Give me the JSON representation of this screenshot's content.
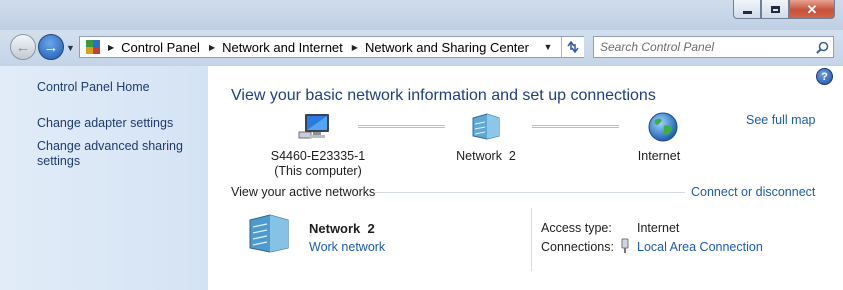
{
  "window": {
    "minimize_label": "Minimize",
    "maximize_label": "Maximize",
    "close_label": "Close"
  },
  "nav": {
    "breadcrumbs": [
      "Control Panel",
      "Network and Internet",
      "Network and Sharing Center"
    ],
    "search_placeholder": "Search Control Panel"
  },
  "sidebar": {
    "items": [
      {
        "label": "Control Panel Home"
      },
      {
        "label": "Change adapter settings"
      },
      {
        "label": "Change advanced sharing settings"
      }
    ]
  },
  "main": {
    "heading": "View your basic network information and set up connections",
    "see_full_map": "See full map",
    "map": {
      "computer_name": "S4460-E23335-1",
      "computer_note": "(This computer)",
      "network_name": "Network  2",
      "internet_label": "Internet"
    },
    "active_networks": {
      "title": "View your active networks",
      "connect_link": "Connect or disconnect",
      "network_name": "Network  2",
      "network_type": "Work network",
      "access_type_label": "Access type:",
      "access_type_value": "Internet",
      "connections_label": "Connections:",
      "connections_value": "Local Area Connection"
    }
  },
  "colors": {
    "heading": "#1e3f88",
    "link": "#1b5ab5",
    "sidebar_bg": "#dbe7f6"
  }
}
